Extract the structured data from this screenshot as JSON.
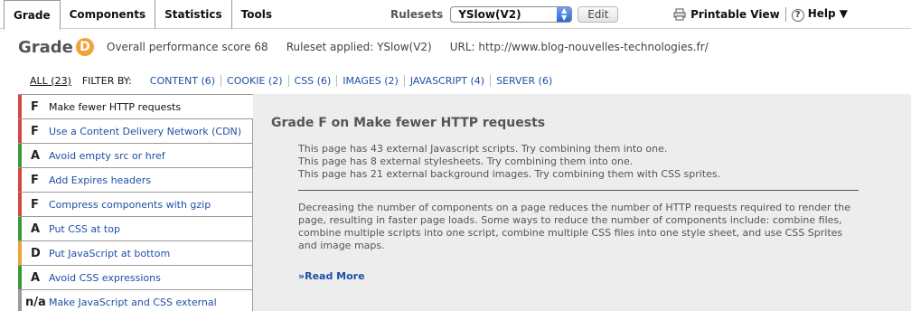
{
  "tabs": [
    "Grade",
    "Components",
    "Statistics",
    "Tools"
  ],
  "rulesets": {
    "label": "Rulesets",
    "selected": "YSlow(V2)",
    "edit_label": "Edit"
  },
  "toplinks": {
    "printable": "Printable View",
    "help": "Help ▼"
  },
  "grade": {
    "word": "Grade",
    "letter": "D",
    "letter_color": "#f0a33a",
    "score_text": "Overall performance score 68",
    "ruleset_text": "Ruleset applied: YSlow(V2)",
    "url_text": "URL: http://www.blog-nouvelles-technologies.fr/"
  },
  "filters": {
    "all": "ALL (23)",
    "filter_by": "FILTER BY:",
    "items": [
      "CONTENT (6)",
      "COOKIE (2)",
      "CSS (6)",
      "IMAGES (2)",
      "JAVASCRIPT (4)",
      "SERVER (6)"
    ]
  },
  "rules": [
    {
      "grade": "F",
      "name": "Make fewer HTTP requests",
      "color": "#d64545"
    },
    {
      "grade": "F",
      "name": "Use a Content Delivery Network (CDN)",
      "color": "#d64545"
    },
    {
      "grade": "A",
      "name": "Avoid empty src or href",
      "color": "#3a9a3a"
    },
    {
      "grade": "F",
      "name": "Add Expires headers",
      "color": "#d64545"
    },
    {
      "grade": "F",
      "name": "Compress components with gzip",
      "color": "#d64545"
    },
    {
      "grade": "A",
      "name": "Put CSS at top",
      "color": "#3a9a3a"
    },
    {
      "grade": "D",
      "name": "Put JavaScript at bottom",
      "color": "#f0a33a"
    },
    {
      "grade": "A",
      "name": "Avoid CSS expressions",
      "color": "#3a9a3a"
    },
    {
      "grade": "n/a",
      "name": "Make JavaScript and CSS external",
      "color": "#9a9a9a"
    }
  ],
  "detail": {
    "title": "Grade F on Make fewer HTTP requests",
    "messages": [
      "This page has 43 external Javascript scripts. Try combining them into one.",
      "This page has 8 external stylesheets. Try combining them into one.",
      "This page has 21 external background images. Try combining them with CSS sprites."
    ],
    "description": "Decreasing the number of components on a page reduces the number of HTTP requests required to render the page, resulting in faster page loads. Some ways to reduce the number of components include: combine files, combine multiple scripts into one script, combine multiple CSS files into one style sheet, and use CSS Sprites and image maps.",
    "read_more": "»Read More"
  }
}
